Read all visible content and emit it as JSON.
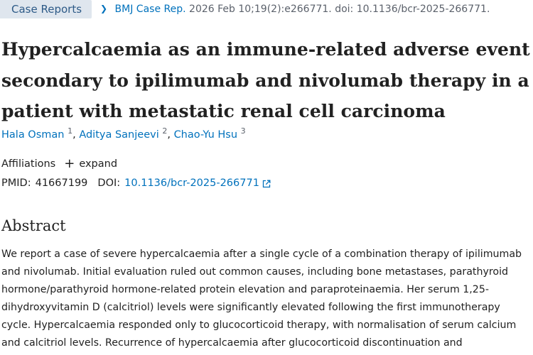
{
  "breadcrumb": {
    "badge_label": "Case Reports",
    "journal": "BMJ Case Rep.",
    "citation_rest": "2026 Feb 10;19(2):e266771. doi: 10.1136/bcr-2025-266771."
  },
  "article": {
    "title": "Hypercalcaemia as an immune-related adverse event secondary to ipilimumab and nivolumab therapy in a patient with metastatic renal cell carcinoma",
    "authors": [
      {
        "name": "Hala Osman",
        "sup": "1"
      },
      {
        "name": "Aditya Sanjeevi",
        "sup": "2"
      },
      {
        "name": "Chao-Yu Hsu",
        "sup": "3"
      }
    ],
    "author_separator": ",",
    "affiliations_label": "Affiliations",
    "expand_label": "expand",
    "pmid_label": "PMID:",
    "pmid": "41667199",
    "doi_label": "DOI:",
    "doi": "10.1136/bcr-2025-266771"
  },
  "abstract": {
    "heading": "Abstract",
    "text": "We report a case of severe hypercalcaemia after a single cycle of a combination therapy of ipilimumab and nivolumab. Initial evaluation ruled out common causes, including bone metastases, parathyroid hormone/parathyroid hormone-related protein elevation and paraproteinaemia. Her serum 1,25-dihydroxyvitamin D (calcitriol) levels were significantly elevated following the first immunotherapy cycle. Hypercalcaemia responded only to glucocorticoid therapy, with normalisation of serum calcium and calcitriol levels. Recurrence of hypercalcaemia after glucocorticoid discontinuation and"
  },
  "colors": {
    "link": "#0071bc",
    "badge_bg": "#dfe6ee",
    "text": "#212121"
  },
  "icons": {
    "breadcrumb_chevron": "chevron-right-icon",
    "expand": "plus-icon",
    "doi_external": "external-link-icon"
  }
}
